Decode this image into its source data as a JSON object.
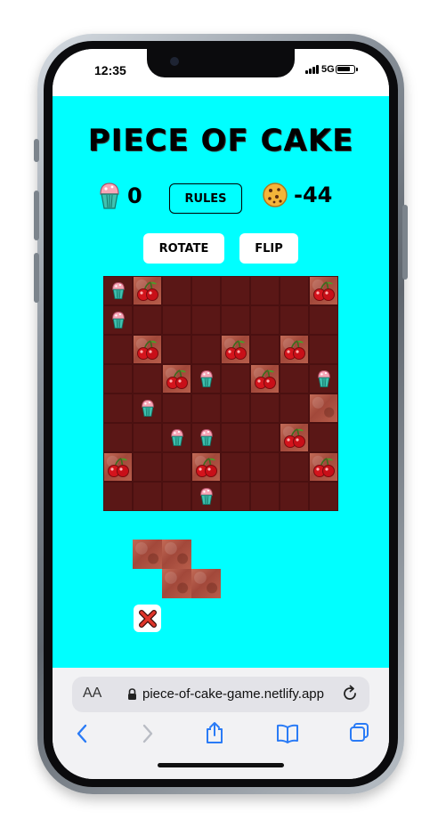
{
  "status_bar": {
    "time": "12:35",
    "network": "5G",
    "battery_level": 0.85
  },
  "game": {
    "title": "PIECE OF CAKE",
    "cupcake_score": "0",
    "rules_label": "RULES",
    "cookie_score": "-44",
    "rotate_label": "ROTATE",
    "flip_label": "FLIP",
    "board": [
      [
        "cupcake",
        "cherry-cake",
        "",
        "",
        "",
        "",
        "",
        "cherry-cake"
      ],
      [
        "cupcake",
        "",
        "",
        "",
        "",
        "",
        "",
        ""
      ],
      [
        "",
        "cherry-cake",
        "",
        "",
        "cherry-cake",
        "",
        "cherry-cake",
        ""
      ],
      [
        "",
        "",
        "cherry-cake",
        "cupcake",
        "",
        "cherry-cake",
        "",
        "cupcake"
      ],
      [
        "",
        "cupcake",
        "",
        "",
        "",
        "",
        "",
        "cake"
      ],
      [
        "",
        "",
        "cupcake",
        "cupcake",
        "",
        "",
        "cherry-cake",
        ""
      ],
      [
        "cherry-cake",
        "",
        "",
        "cherry-cake",
        "",
        "",
        "",
        "cherry-cake"
      ],
      [
        "",
        "",
        "",
        "cupcake",
        "",
        "",
        "",
        ""
      ]
    ],
    "current_piece": [
      [
        1,
        1,
        0
      ],
      [
        0,
        1,
        1
      ]
    ]
  },
  "browser": {
    "aa_label": "AA",
    "url": "piece-of-cake-game.netlify.app"
  },
  "icons": {
    "cupcake": "cupcake-icon",
    "cookie": "cookie-icon",
    "cherry": "cherry-icon",
    "cancel": "close-icon"
  },
  "colors": {
    "background": "#00ffff",
    "board": "#5a1716",
    "cake": "#b35a47",
    "cancel_red": "#e0352b"
  }
}
